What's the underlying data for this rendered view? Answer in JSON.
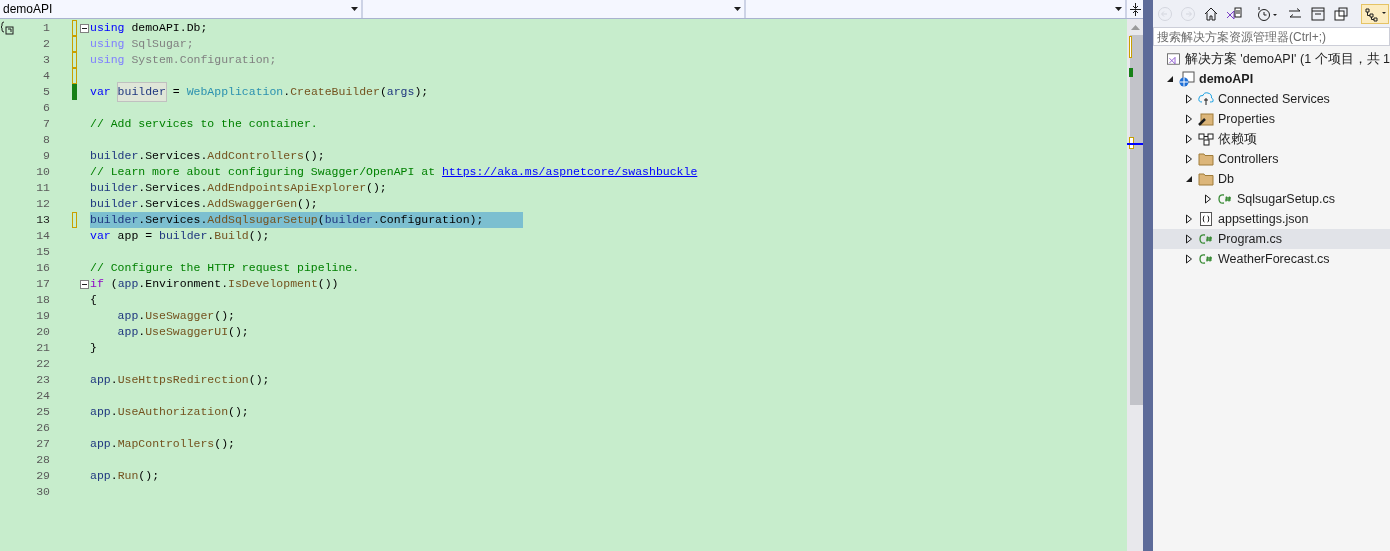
{
  "editor": {
    "navigation_bar": {
      "project_dropdown": "demoAPI"
    },
    "lines": [
      {
        "number": "1",
        "modified": true,
        "saved": false,
        "fold": true,
        "current": false,
        "selected": false,
        "quick_action": true,
        "tokens": [
          {
            "kind": "keyword",
            "text": "using"
          },
          {
            "kind": "plain",
            "text": " demoAPI.Db;"
          }
        ]
      },
      {
        "number": "2",
        "modified": true,
        "saved": false,
        "fold": false,
        "current": false,
        "selected": false,
        "quick_action": false,
        "tokens": [
          {
            "kind": "faded-keyword",
            "text": "using"
          },
          {
            "kind": "faded",
            "text": " SqlSugar;"
          }
        ]
      },
      {
        "number": "3",
        "modified": true,
        "saved": false,
        "fold": false,
        "current": false,
        "selected": false,
        "quick_action": false,
        "tokens": [
          {
            "kind": "faded-keyword",
            "text": "using"
          },
          {
            "kind": "faded",
            "text": " System.Configuration;"
          }
        ]
      },
      {
        "number": "4",
        "modified": true,
        "saved": false,
        "fold": false,
        "current": false,
        "selected": false,
        "quick_action": false
      },
      {
        "number": "5",
        "modified": true,
        "saved": true,
        "fold": false,
        "current": false,
        "selected": false,
        "quick_action": false,
        "tokens": [
          {
            "kind": "keyword",
            "text": "var"
          },
          {
            "kind": "reference",
            "text": "builder"
          },
          {
            "kind": "plain",
            "text": " = "
          },
          {
            "kind": "type",
            "text": "WebApplication"
          },
          {
            "kind": "plain",
            "text": "."
          },
          {
            "kind": "method",
            "text": "CreateBuilder"
          },
          {
            "kind": "plain",
            "text": "("
          },
          {
            "kind": "ident",
            "text": "args"
          },
          {
            "kind": "plain",
            "text": ");"
          }
        ]
      },
      {
        "number": "6",
        "modified": false,
        "fold": false,
        "current": false,
        "selected": false,
        "quick_action": false
      },
      {
        "number": "7",
        "modified": false,
        "fold": false,
        "current": false,
        "selected": false,
        "quick_action": false,
        "tokens": [
          {
            "kind": "comment",
            "text": "// Add services to the container."
          }
        ]
      },
      {
        "number": "8",
        "modified": false,
        "fold": false,
        "current": false,
        "selected": false,
        "quick_action": false
      },
      {
        "number": "9",
        "modified": false,
        "fold": false,
        "current": false,
        "selected": false,
        "quick_action": false,
        "tokens": [
          {
            "kind": "ident",
            "text": "builder"
          },
          {
            "kind": "plain",
            "text": ".Services."
          },
          {
            "kind": "method",
            "text": "AddControllers"
          },
          {
            "kind": "plain",
            "text": "();"
          }
        ]
      },
      {
        "number": "10",
        "modified": false,
        "fold": false,
        "current": false,
        "selected": false,
        "quick_action": false,
        "tokens": [
          {
            "kind": "comment",
            "text": "// Learn more about configuring Swagger/OpenAPI at "
          },
          {
            "kind": "link",
            "text": "https://aka.ms/aspnetcore/swashbuckle"
          }
        ]
      },
      {
        "number": "11",
        "modified": false,
        "fold": false,
        "current": false,
        "selected": false,
        "quick_action": false,
        "tokens": [
          {
            "kind": "ident",
            "text": "builder"
          },
          {
            "kind": "plain",
            "text": ".Services."
          },
          {
            "kind": "method",
            "text": "AddEndpointsApiExplorer"
          },
          {
            "kind": "plain",
            "text": "();"
          }
        ]
      },
      {
        "number": "12",
        "modified": false,
        "fold": false,
        "current": false,
        "selected": false,
        "quick_action": false,
        "tokens": [
          {
            "kind": "ident",
            "text": "builder"
          },
          {
            "kind": "plain",
            "text": ".Services."
          },
          {
            "kind": "method",
            "text": "AddSwaggerGen"
          },
          {
            "kind": "plain",
            "text": "();"
          }
        ]
      },
      {
        "number": "13",
        "modified": true,
        "saved": false,
        "fold": false,
        "current": true,
        "selected": true,
        "quick_action": false,
        "tokens": [
          {
            "kind": "ident",
            "text": "builder"
          },
          {
            "kind": "plain",
            "text": ".Services."
          },
          {
            "kind": "method",
            "text": "AddSqlsugarSetup"
          },
          {
            "kind": "plain",
            "text": "("
          },
          {
            "kind": "ident",
            "text": "builder"
          },
          {
            "kind": "plain",
            "text": ".Configuration);"
          }
        ]
      },
      {
        "number": "14",
        "modified": false,
        "fold": false,
        "current": false,
        "selected": false,
        "quick_action": false,
        "tokens": [
          {
            "kind": "keyword",
            "text": "var"
          },
          {
            "kind": "plain",
            "text": " app = "
          },
          {
            "kind": "ident",
            "text": "builder"
          },
          {
            "kind": "plain",
            "text": "."
          },
          {
            "kind": "method",
            "text": "Build"
          },
          {
            "kind": "plain",
            "text": "();"
          }
        ]
      },
      {
        "number": "15",
        "modified": false,
        "fold": false,
        "current": false,
        "selected": false,
        "quick_action": false
      },
      {
        "number": "16",
        "modified": false,
        "fold": false,
        "current": false,
        "selected": false,
        "quick_action": false,
        "tokens": [
          {
            "kind": "comment",
            "text": "// Configure the HTTP request pipeline."
          }
        ]
      },
      {
        "number": "17",
        "modified": false,
        "fold": true,
        "current": false,
        "selected": false,
        "quick_action": false,
        "tokens": [
          {
            "kind": "control",
            "text": "if"
          },
          {
            "kind": "plain",
            "text": " ("
          },
          {
            "kind": "ident",
            "text": "app"
          },
          {
            "kind": "plain",
            "text": ".Environment."
          },
          {
            "kind": "method",
            "text": "IsDevelopment"
          },
          {
            "kind": "plain",
            "text": "())"
          }
        ]
      },
      {
        "number": "18",
        "modified": false,
        "fold": false,
        "current": false,
        "selected": false,
        "quick_action": false,
        "tokens": [
          {
            "kind": "plain",
            "text": "{"
          }
        ],
        "children": [
          {
            "number": "19",
            "modified": false,
            "fold": false,
            "current": false,
            "selected": false,
            "quick_action": false,
            "tokens": [
              {
                "kind": "ident",
                "text": "app"
              },
              {
                "kind": "plain",
                "text": "."
              },
              {
                "kind": "method",
                "text": "UseSwagger"
              },
              {
                "kind": "plain",
                "text": "();"
              }
            ]
          },
          {
            "number": "20",
            "modified": false,
            "fold": false,
            "current": false,
            "selected": false,
            "quick_action": false,
            "tokens": [
              {
                "kind": "ident",
                "text": "app"
              },
              {
                "kind": "plain",
                "text": "."
              },
              {
                "kind": "method",
                "text": "UseSwaggerUI"
              },
              {
                "kind": "plain",
                "text": "();"
              }
            ]
          }
        ]
      },
      {
        "number": "21",
        "modified": false,
        "fold": false,
        "current": false,
        "selected": false,
        "quick_action": false,
        "tokens": [
          {
            "kind": "plain",
            "text": "}"
          }
        ]
      },
      {
        "number": "22",
        "modified": false,
        "fold": false,
        "current": false,
        "selected": false,
        "quick_action": false
      },
      {
        "number": "23",
        "modified": false,
        "fold": false,
        "current": false,
        "selected": false,
        "quick_action": false,
        "tokens": [
          {
            "kind": "ident",
            "text": "app"
          },
          {
            "kind": "plain",
            "text": "."
          },
          {
            "kind": "method",
            "text": "UseHttpsRedirection"
          },
          {
            "kind": "plain",
            "text": "();"
          }
        ]
      },
      {
        "number": "24",
        "modified": false,
        "fold": false,
        "current": false,
        "selected": false,
        "quick_action": false
      },
      {
        "number": "25",
        "modified": false,
        "fold": false,
        "current": false,
        "selected": false,
        "quick_action": false,
        "tokens": [
          {
            "kind": "ident",
            "text": "app"
          },
          {
            "kind": "plain",
            "text": "."
          },
          {
            "kind": "method",
            "text": "UseAuthorization"
          },
          {
            "kind": "plain",
            "text": "();"
          }
        ]
      },
      {
        "number": "26",
        "modified": false,
        "fold": false,
        "current": false,
        "selected": false,
        "quick_action": false
      },
      {
        "number": "27",
        "modified": false,
        "fold": false,
        "current": false,
        "selected": false,
        "quick_action": false,
        "tokens": [
          {
            "kind": "ident",
            "text": "app"
          },
          {
            "kind": "plain",
            "text": "."
          },
          {
            "kind": "method",
            "text": "MapControllers"
          },
          {
            "kind": "plain",
            "text": "();"
          }
        ]
      },
      {
        "number": "28",
        "modified": false,
        "fold": false,
        "current": false,
        "selected": false,
        "quick_action": false
      },
      {
        "number": "29",
        "modified": false,
        "fold": false,
        "current": false,
        "selected": false,
        "quick_action": false,
        "tokens": [
          {
            "kind": "ident",
            "text": "app"
          },
          {
            "kind": "plain",
            "text": "."
          },
          {
            "kind": "method",
            "text": "Run"
          },
          {
            "kind": "plain",
            "text": "();"
          }
        ]
      },
      {
        "number": "30",
        "modified": false,
        "fold": false,
        "current": false,
        "selected": false,
        "quick_action": false
      }
    ]
  },
  "solution_explorer": {
    "toolbar": [
      {
        "kind": "back",
        "disabled": true,
        "on": false
      },
      {
        "kind": "forward",
        "disabled": true,
        "on": false
      },
      {
        "kind": "home",
        "disabled": false,
        "on": false
      },
      {
        "kind": "switch-views",
        "disabled": false,
        "on": false
      },
      {
        "kind": "separator"
      },
      {
        "kind": "history",
        "disabled": false,
        "on": false
      },
      {
        "kind": "sync",
        "disabled": false,
        "on": false
      },
      {
        "kind": "collapse",
        "disabled": false,
        "on": false
      },
      {
        "kind": "copies",
        "disabled": false,
        "on": false
      },
      {
        "kind": "separator"
      },
      {
        "kind": "properties-view",
        "disabled": false,
        "on": true
      }
    ],
    "search": {
      "placeholder": "搜索解决方案资源管理器(Ctrl+;)"
    },
    "solution": {
      "label": "解决方案 'demoAPI' (1 个项目，共 1"
    },
    "tree": [
      {
        "label": "demoAPI",
        "kind": "project",
        "expanded": true,
        "selected": false,
        "children": [
          {
            "label": "Connected Services",
            "kind": "connected",
            "expanded": false,
            "selected": false
          },
          {
            "label": "Properties",
            "kind": "properties",
            "expanded": false,
            "selected": false
          },
          {
            "label": "依赖项",
            "kind": "dependencies",
            "expanded": false,
            "selected": false
          },
          {
            "label": "Controllers",
            "kind": "folder",
            "expanded": false,
            "selected": false
          },
          {
            "label": "Db",
            "kind": "folder",
            "expanded": true,
            "selected": false,
            "children": [
              {
                "label": "SqlsugarSetup.cs",
                "kind": "csharp",
                "expanded": false,
                "selected": false
              }
            ]
          },
          {
            "label": "appsettings.json",
            "kind": "json",
            "expanded": false,
            "selected": false
          },
          {
            "label": "Program.cs",
            "kind": "csharp",
            "expanded": false,
            "selected": true
          },
          {
            "label": "WeatherForecast.cs",
            "kind": "csharp",
            "expanded": false,
            "selected": false
          }
        ]
      }
    ]
  }
}
